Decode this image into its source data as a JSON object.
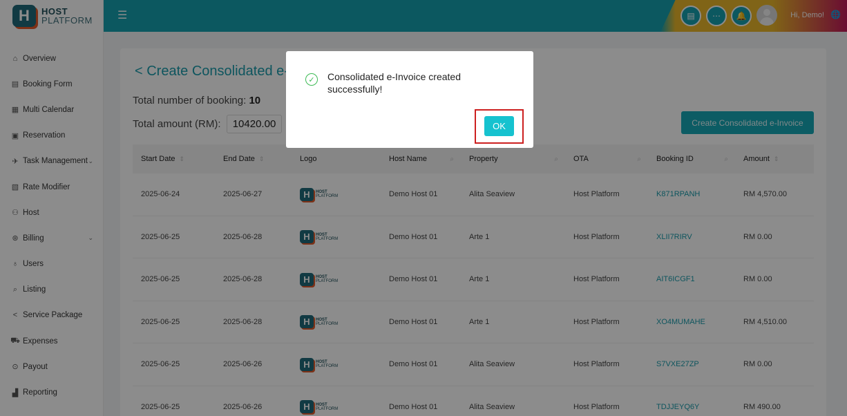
{
  "logo": {
    "line1": "HOST",
    "line2": "PLATFORM",
    "mark": "H"
  },
  "sidebar": {
    "items": [
      {
        "label": "Overview",
        "icon": "⌂",
        "chevron": ""
      },
      {
        "label": "Booking Form",
        "icon": "▤",
        "chevron": ""
      },
      {
        "label": "Multi Calendar",
        "icon": "▦",
        "chevron": ""
      },
      {
        "label": "Reservation",
        "icon": "▣",
        "chevron": ""
      },
      {
        "label": "Task Management",
        "icon": "✈",
        "chevron": "⌄"
      },
      {
        "label": "Rate Modifier",
        "icon": "▧",
        "chevron": ""
      },
      {
        "label": "Host",
        "icon": "⚇",
        "chevron": ""
      },
      {
        "label": "Billing",
        "icon": "⊛",
        "chevron": "⌄"
      },
      {
        "label": "Users",
        "icon": "♁",
        "chevron": ""
      },
      {
        "label": "Listing",
        "icon": "⌕",
        "chevron": ""
      },
      {
        "label": "Service Package",
        "icon": "<",
        "chevron": ""
      },
      {
        "label": "Expenses",
        "icon": "⛟",
        "chevron": ""
      },
      {
        "label": "Payout",
        "icon": "⊙",
        "chevron": ""
      },
      {
        "label": "Reporting",
        "icon": "▟",
        "chevron": ""
      }
    ]
  },
  "topbar": {
    "greeting": "Hi, Demo!",
    "menu_icon": "☰",
    "icon1": "▤",
    "icon2": "⋯",
    "icon3": "🔔",
    "globe": "🌐"
  },
  "page": {
    "title": "< Create Consolidated e-I",
    "total_booking_label": "Total number of booking:",
    "total_booking_value": "10",
    "total_amount_label": "Total amount (RM):",
    "total_amount_value": "10420.00",
    "create_button": "Create Consolidated e-Invoice"
  },
  "table": {
    "headers": [
      "Start Date",
      "End Date",
      "Logo",
      "Host Name",
      "Property",
      "OTA",
      "Booking ID",
      "Amount"
    ],
    "rows": [
      {
        "start": "2025-06-24",
        "end": "2025-06-27",
        "host": "Demo Host 01",
        "property": "Alita Seaview",
        "ota": "Host Platform",
        "booking": "K871RPANH",
        "amount": "RM 4,570.00"
      },
      {
        "start": "2025-06-25",
        "end": "2025-06-28",
        "host": "Demo Host 01",
        "property": "Arte 1",
        "ota": "Host Platform",
        "booking": "XLII7RIRV",
        "amount": "RM 0.00"
      },
      {
        "start": "2025-06-25",
        "end": "2025-06-28",
        "host": "Demo Host 01",
        "property": "Arte 1",
        "ota": "Host Platform",
        "booking": "AIT6ICGF1",
        "amount": "RM 0.00"
      },
      {
        "start": "2025-06-25",
        "end": "2025-06-28",
        "host": "Demo Host 01",
        "property": "Arte 1",
        "ota": "Host Platform",
        "booking": "XO4MUMAHE",
        "amount": "RM 4,510.00"
      },
      {
        "start": "2025-06-25",
        "end": "2025-06-26",
        "host": "Demo Host 01",
        "property": "Alita Seaview",
        "ota": "Host Platform",
        "booking": "S7VXE27ZP",
        "amount": "RM 0.00"
      },
      {
        "start": "2025-06-25",
        "end": "2025-06-26",
        "host": "Demo Host 01",
        "property": "Alita Seaview",
        "ota": "Host Platform",
        "booking": "TDJJEYQ6Y",
        "amount": "RM 490.00"
      }
    ]
  },
  "modal": {
    "message": "Consolidated e-Invoice created successfully!",
    "ok_label": "OK",
    "check_icon": "✓"
  },
  "colors": {
    "accent": "#16a1b0",
    "brand_dark": "#1f6b7a",
    "ok_button": "#16c2cf",
    "highlight_frame": "#cc1f1f"
  }
}
